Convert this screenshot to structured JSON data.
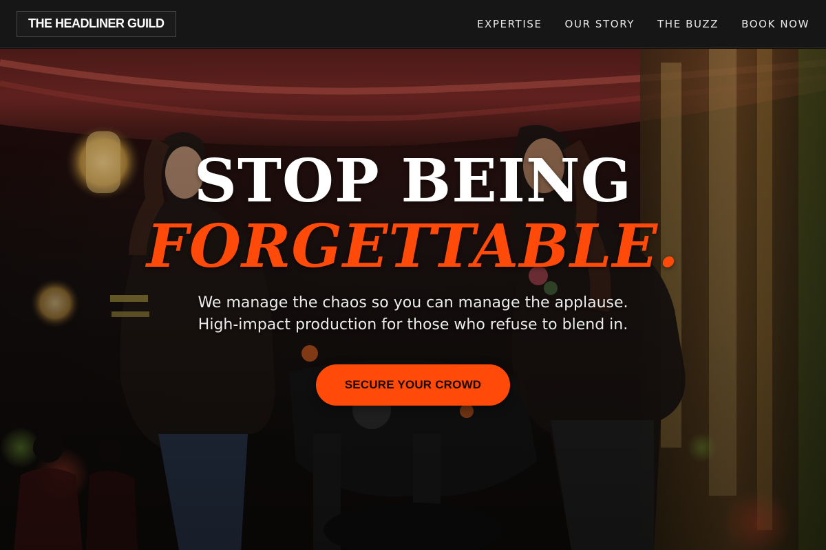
{
  "brand": {
    "name": "THE HEADLINER GUILD"
  },
  "nav": {
    "items": [
      "EXPERTISE",
      "OUR STORY",
      "THE BUZZ",
      "BOOK NOW"
    ]
  },
  "hero": {
    "headline_line1": "STOP BEING",
    "headline_line2": "FORGETTABLE.",
    "sub_line1": "We manage the chaos so you can manage the applause.",
    "sub_line2": "High-impact production for those who refuse to blend in.",
    "cta_label": "SECURE YOUR CROWD",
    "background_image": "two women in leather jackets posing with a motorcycle at a decorated venue"
  },
  "colors": {
    "accent": "#ff4a0a",
    "header_bg": "#161616",
    "headline_white": "#ffffff"
  }
}
